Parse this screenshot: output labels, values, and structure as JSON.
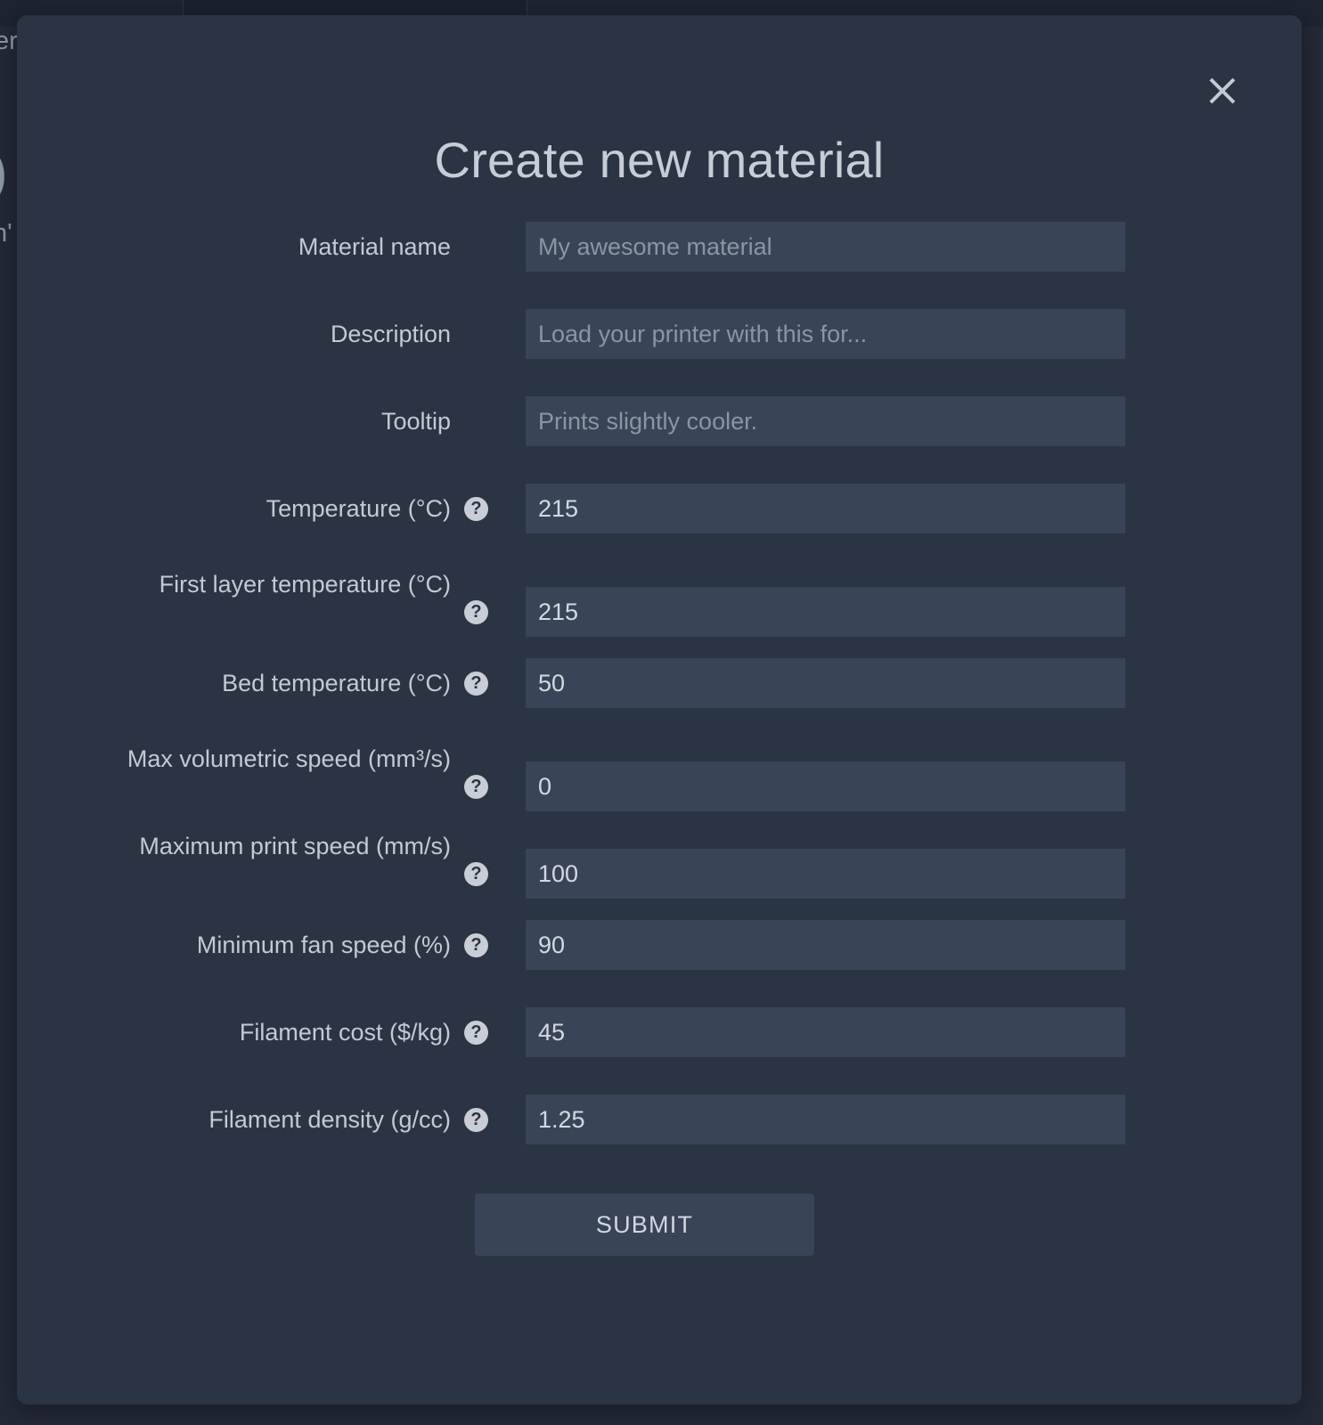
{
  "backdrop": {
    "fragments": [
      {
        "text": "er"
      },
      {
        "text": ")"
      },
      {
        "text": "n'"
      }
    ]
  },
  "dialog": {
    "title": "Create new material",
    "close_label": "×",
    "close_icon": "close-icon",
    "help_icon_glyph": "?",
    "submit_label": "SUBMIT",
    "fields": [
      {
        "label": "Material name",
        "placeholder": "My awesome material",
        "value": "",
        "has_help": false,
        "two_line": false
      },
      {
        "label": "Description",
        "placeholder": "Load your printer with this for...",
        "value": "",
        "has_help": false,
        "two_line": false
      },
      {
        "label": "Tooltip",
        "placeholder": "Prints slightly cooler.",
        "value": "",
        "has_help": false,
        "two_line": false
      },
      {
        "label": "Temperature (°C)",
        "placeholder": "",
        "value": "215",
        "has_help": true,
        "two_line": false
      },
      {
        "label": "First layer temperature (°C)",
        "placeholder": "",
        "value": "215",
        "has_help": true,
        "two_line": true
      },
      {
        "label": "Bed temperature (°C)",
        "placeholder": "",
        "value": "50",
        "has_help": true,
        "two_line": false
      },
      {
        "label": "Max volumetric speed (mm³/s)",
        "placeholder": "",
        "value": "0",
        "has_help": true,
        "two_line": true
      },
      {
        "label": "Maximum print speed (mm/s)",
        "placeholder": "",
        "value": "100",
        "has_help": true,
        "two_line": true
      },
      {
        "label": "Minimum fan speed (%)",
        "placeholder": "",
        "value": "90",
        "has_help": true,
        "two_line": false
      },
      {
        "label": "Filament cost ($/kg)",
        "placeholder": "",
        "value": "45",
        "has_help": true,
        "two_line": false
      },
      {
        "label": "Filament density (g/cc)",
        "placeholder": "",
        "value": "1.25",
        "has_help": true,
        "two_line": false
      }
    ]
  },
  "colors": {
    "page_background": "#1d222e",
    "backdrop": "#232936",
    "dialog_background": "#2a3442",
    "field_background": "#394557",
    "button_background": "#394457",
    "text_primary": "#c6cdd6",
    "text_placeholder": "#8b95a3",
    "help_icon_background": "#c9ced6"
  }
}
